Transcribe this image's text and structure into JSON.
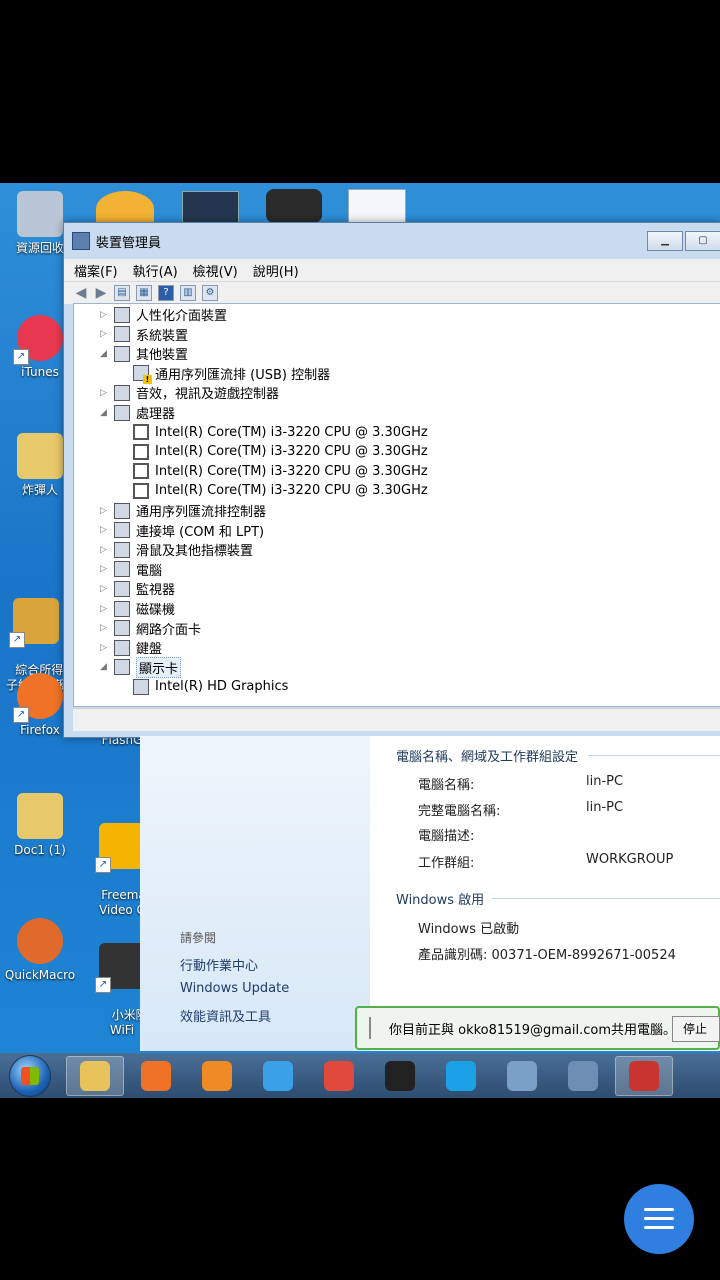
{
  "desktop": {
    "icons": [
      {
        "label": "資源回收",
        "color": "#b8c6d6"
      },
      {
        "label": "iTunes",
        "color": "#e8384f"
      },
      {
        "label": "炸彈人",
        "color": "#e7c86a"
      },
      {
        "label": "綜合所得稅\n子結算申報",
        "color": "#d9a43a"
      },
      {
        "label": "Firefox",
        "color": "#f07226"
      },
      {
        "label": "Doc1 (1)",
        "color": "#e7c86a"
      },
      {
        "label": "QuickMacro",
        "color": "#e06a2b"
      },
      {
        "label": "FlashG",
        "color": "#9b9b9b"
      },
      {
        "label": "Freemake\nVideo C",
        "color": "#f4b400"
      },
      {
        "label": "小米隨\nWiFi",
        "color": "#333333"
      }
    ]
  },
  "device_manager": {
    "title": "裝置管理員",
    "menu": [
      "檔案(F)",
      "執行(A)",
      "檢視(V)",
      "說明(H)"
    ],
    "tree": [
      {
        "label": "人性化介面裝置",
        "indent": 0,
        "exp": "▷",
        "icon": "hid-icon"
      },
      {
        "label": "系統裝置",
        "indent": 0,
        "exp": "▷",
        "icon": "system-device-icon"
      },
      {
        "label": "其他裝置",
        "indent": 0,
        "exp": "◢",
        "icon": "other-device-icon"
      },
      {
        "label": "通用序列匯流排 (USB) 控制器",
        "indent": 1,
        "exp": "",
        "icon": "usb-warning-icon"
      },
      {
        "label": "音效，視訊及遊戲控制器",
        "indent": 0,
        "exp": "▷",
        "icon": "speaker-icon"
      },
      {
        "label": "處理器",
        "indent": 0,
        "exp": "◢",
        "icon": "processor-icon"
      },
      {
        "label": "Intel(R) Core(TM) i3-3220 CPU @ 3.30GHz",
        "indent": 1,
        "exp": "",
        "icon": "cpu-icon"
      },
      {
        "label": "Intel(R) Core(TM) i3-3220 CPU @ 3.30GHz",
        "indent": 1,
        "exp": "",
        "icon": "cpu-icon"
      },
      {
        "label": "Intel(R) Core(TM) i3-3220 CPU @ 3.30GHz",
        "indent": 1,
        "exp": "",
        "icon": "cpu-icon"
      },
      {
        "label": "Intel(R) Core(TM) i3-3220 CPU @ 3.30GHz",
        "indent": 1,
        "exp": "",
        "icon": "cpu-icon"
      },
      {
        "label": "通用序列匯流排控制器",
        "indent": 0,
        "exp": "▷",
        "icon": "usb-icon"
      },
      {
        "label": "連接埠 (COM 和 LPT)",
        "indent": 0,
        "exp": "▷",
        "icon": "port-icon"
      },
      {
        "label": "滑鼠及其他指標裝置",
        "indent": 0,
        "exp": "▷",
        "icon": "mouse-icon"
      },
      {
        "label": "電腦",
        "indent": 0,
        "exp": "▷",
        "icon": "computer-icon"
      },
      {
        "label": "監視器",
        "indent": 0,
        "exp": "▷",
        "icon": "monitor-icon"
      },
      {
        "label": "磁碟機",
        "indent": 0,
        "exp": "▷",
        "icon": "disk-icon"
      },
      {
        "label": "網路介面卡",
        "indent": 0,
        "exp": "▷",
        "icon": "network-icon"
      },
      {
        "label": "鍵盤",
        "indent": 0,
        "exp": "▷",
        "icon": "keyboard-icon"
      },
      {
        "label": "顯示卡",
        "indent": 0,
        "exp": "◢",
        "icon": "display-adapter-icon",
        "selected": true
      },
      {
        "label": "Intel(R) HD Graphics",
        "indent": 1,
        "exp": "",
        "icon": "display-adapter-icon"
      }
    ]
  },
  "system": {
    "section_computer": "電腦名稱、網域及工作群組設定",
    "fields": [
      {
        "label": "電腦名稱:",
        "value": "lin-PC"
      },
      {
        "label": "完整電腦名稱:",
        "value": "lin-PC"
      },
      {
        "label": "電腦描述:",
        "value": ""
      },
      {
        "label": "工作群組:",
        "value": "WORKGROUP"
      }
    ],
    "section_activation": "Windows 啟用",
    "activated": "Windows 已啟動",
    "product_id": "產品識別碼: 00371-OEM-8992671-00524",
    "see_also": "請參閱",
    "links": [
      "行動作業中心",
      "Windows Update",
      "效能資訊及工具"
    ]
  },
  "share": {
    "text": "你目前正與 okko81519@gmail.com共用電腦。",
    "stop": "停止"
  },
  "taskbar": {
    "items": [
      {
        "name": "explorer",
        "color": "#e8c35a",
        "active": true
      },
      {
        "name": "firefox",
        "color": "#f07226",
        "active": false
      },
      {
        "name": "media-player",
        "color": "#f08a24",
        "active": false
      },
      {
        "name": "internet-explorer",
        "color": "#3aa0e8",
        "active": false
      },
      {
        "name": "chrome",
        "color": "#e04a3a",
        "active": false
      },
      {
        "name": "nox",
        "color": "#222222",
        "active": false
      },
      {
        "name": "skype",
        "color": "#1da1e6",
        "active": false
      },
      {
        "name": "remote",
        "color": "#7aa0c8",
        "active": false
      },
      {
        "name": "system",
        "color": "#6d8fb3",
        "active": false
      },
      {
        "name": "toolbox",
        "color": "#c9342e",
        "active": true
      }
    ]
  }
}
